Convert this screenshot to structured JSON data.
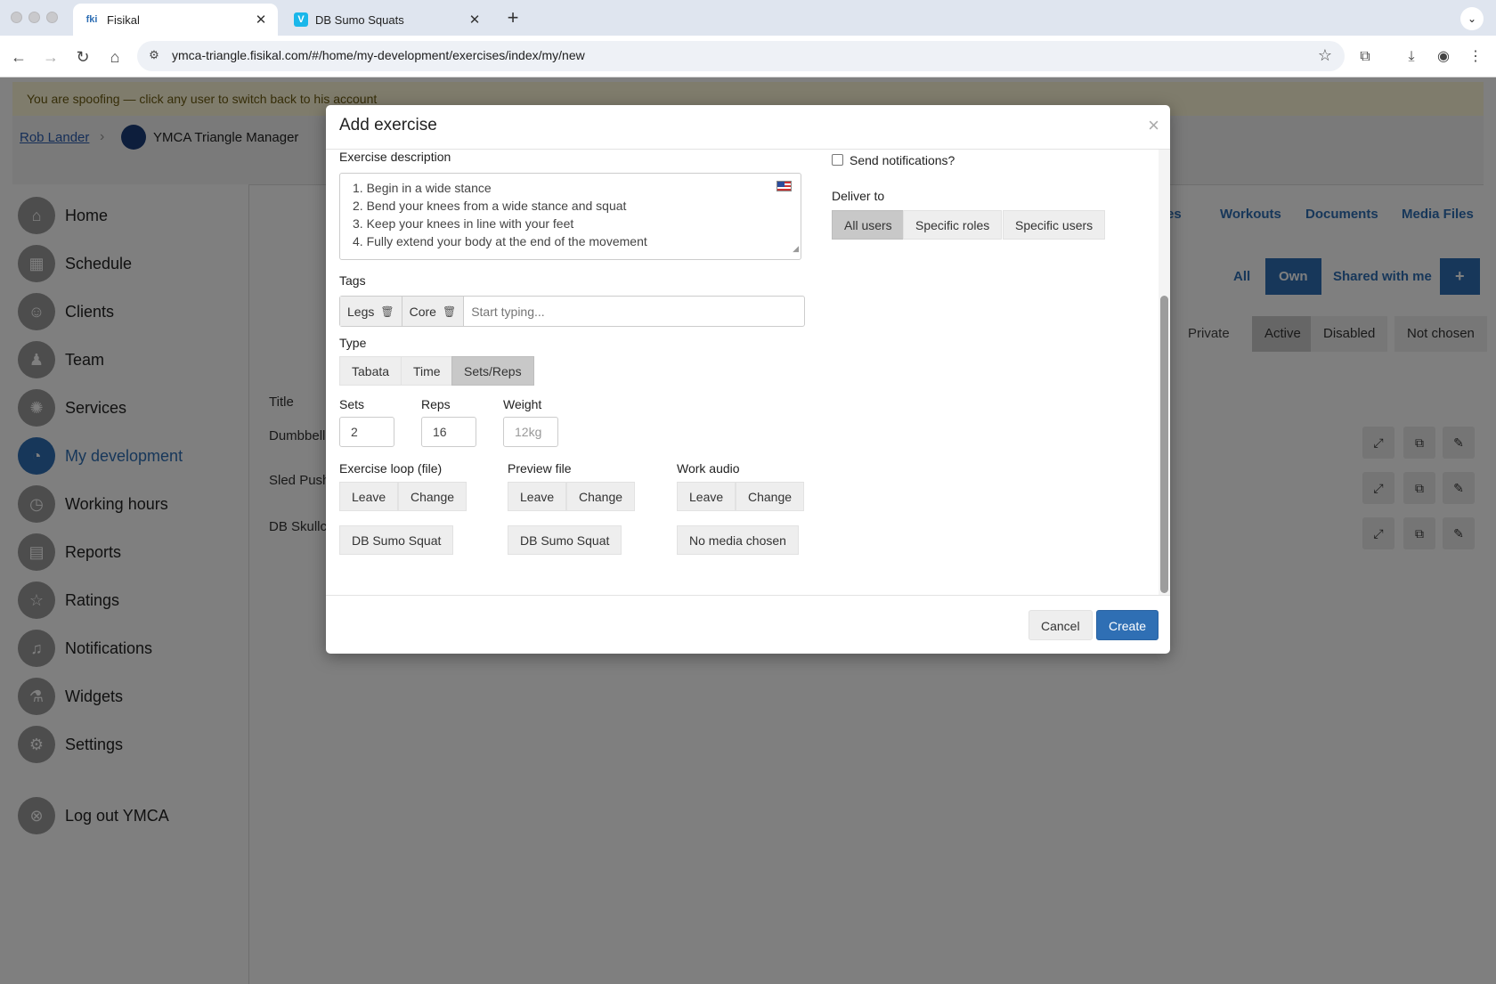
{
  "browser": {
    "tabs": [
      {
        "title": "Fisikal",
        "favicon": "fki"
      },
      {
        "title": "DB Sumo Squats",
        "favicon": "V"
      }
    ],
    "url": "ymca-triangle.fisikal.com/#/home/my-development/exercises/index/my/new"
  },
  "app": {
    "spoof_banner": "You are spoofing — click any user to switch back to his account",
    "breadcrumb": {
      "user": "Rob Lander",
      "manager": "YMCA Triangle Manager"
    },
    "sidebar": [
      {
        "label": "Home",
        "icon": "home-icon"
      },
      {
        "label": "Schedule",
        "icon": "calendar-icon"
      },
      {
        "label": "Clients",
        "icon": "clients-icon"
      },
      {
        "label": "Team",
        "icon": "team-icon"
      },
      {
        "label": "Services",
        "icon": "services-icon"
      },
      {
        "label": "My development",
        "icon": "dashboard-icon"
      },
      {
        "label": "Working hours",
        "icon": "clock-icon"
      },
      {
        "label": "Reports",
        "icon": "reports-icon"
      },
      {
        "label": "Ratings",
        "icon": "star-icon"
      },
      {
        "label": "Notifications",
        "icon": "bell-icon"
      },
      {
        "label": "Widgets",
        "icon": "flask-icon"
      },
      {
        "label": "Settings",
        "icon": "gear-icon"
      },
      {
        "label": "Log out YMCA",
        "icon": "logout-icon"
      }
    ],
    "top_links": {
      "partial": "ries",
      "workouts": "Workouts",
      "documents": "Documents",
      "media": "Media Files"
    },
    "scope": {
      "all": "All",
      "own": "Own",
      "shared": "Shared with me",
      "add": "+"
    },
    "filters": {
      "private": "Private",
      "active": "Active",
      "disabled": "Disabled",
      "not_chosen": "Not chosen"
    },
    "table": {
      "title_header": "Title",
      "rows": [
        "Dumbbell",
        "Sled Push",
        "DB Skullc"
      ]
    }
  },
  "modal": {
    "title": "Add exercise",
    "close": "×",
    "description_label": "Exercise description",
    "description_lines": [
      "1. Begin in a wide stance",
      "2. Bend your knees from a wide stance and squat",
      "3. Keep your knees in line with your feet",
      "4. Fully extend your body at the end of the movement"
    ],
    "tags_label": "Tags",
    "tags": [
      "Legs",
      "Core"
    ],
    "tags_placeholder": "Start typing...",
    "type_label": "Type",
    "types": [
      "Tabata",
      "Time",
      "Sets/Reps"
    ],
    "selected_type": "Sets/Reps",
    "sets_label": "Sets",
    "sets_value": "2",
    "reps_label": "Reps",
    "reps_value": "16",
    "weight_label": "Weight",
    "weight_placeholder": "12kg",
    "loop_label": "Exercise loop (file)",
    "preview_label": "Preview file",
    "audio_label": "Work audio",
    "leave": "Leave",
    "change": "Change",
    "loop_file": "DB Sumo Squat",
    "preview_file": "DB Sumo Squat",
    "audio_file": "No media chosen",
    "send_notifications": "Send notifications?",
    "deliver_to_label": "Deliver to",
    "deliver_options": [
      "All users",
      "Specific roles",
      "Specific users"
    ],
    "selected_deliver": "All users",
    "cancel": "Cancel",
    "create": "Create"
  },
  "colors": {
    "primary": "#2f6fb4",
    "overlay": "rgba(0,0,0,0.5)"
  }
}
